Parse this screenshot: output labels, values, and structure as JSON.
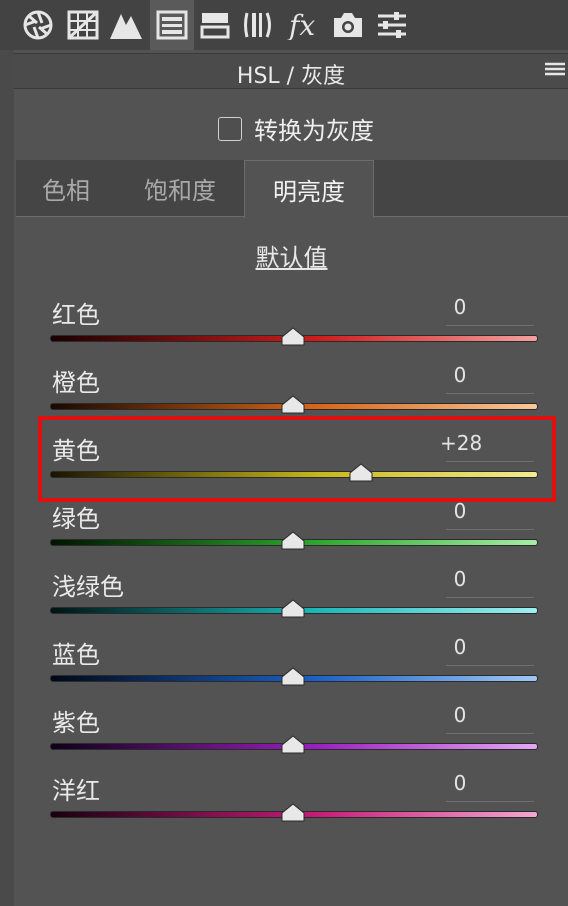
{
  "toolbar": {
    "tools": [
      {
        "icon": "aperture-icon"
      },
      {
        "icon": "tone-curve-grid-icon"
      },
      {
        "icon": "mountain-detail-icon"
      },
      {
        "icon": "hsl-panel-icon",
        "active": true
      },
      {
        "icon": "split-toning-icon"
      },
      {
        "icon": "lens-corrections-icon"
      },
      {
        "icon": "fx-icon"
      },
      {
        "icon": "camera-icon"
      },
      {
        "icon": "sliders-presets-icon"
      }
    ]
  },
  "panel": {
    "title": "HSL / 灰度",
    "menu_icon": "panel-menu-icon"
  },
  "convert_gray": {
    "label": "转换为灰度",
    "checked": false
  },
  "tabs": [
    {
      "label": "色相",
      "active": false
    },
    {
      "label": "饱和度",
      "active": false
    },
    {
      "label": "明亮度",
      "active": true
    }
  ],
  "default_link": "默认值",
  "sliders": [
    {
      "label": "红色",
      "value": "0",
      "level": 0
    },
    {
      "label": "橙色",
      "value": "0",
      "level": 0
    },
    {
      "label": "黄色",
      "value": "+28",
      "level": 28
    },
    {
      "label": "绿色",
      "value": "0",
      "level": 0
    },
    {
      "label": "浅绿色",
      "value": "0",
      "level": 0
    },
    {
      "label": "蓝色",
      "value": "0",
      "level": 0
    },
    {
      "label": "紫色",
      "value": "0",
      "level": 0
    },
    {
      "label": "洋红",
      "value": "0",
      "level": 0
    }
  ],
  "colors": {
    "highlight": "#e01010",
    "tracks": [
      [
        "#1a0000",
        "#d01c1c",
        "#f5a0a0"
      ],
      [
        "#1a0800",
        "#d8661a",
        "#f8c898"
      ],
      [
        "#1a1400",
        "#c8b818",
        "#f4ec90"
      ],
      [
        "#001400",
        "#2ea82e",
        "#a8eca8"
      ],
      [
        "#001414",
        "#1cb8b8",
        "#a0f0f0"
      ],
      [
        "#000818",
        "#1c62c8",
        "#a0c8f4"
      ],
      [
        "#100018",
        "#9c20c0",
        "#e4a8f4"
      ],
      [
        "#180010",
        "#c81c78",
        "#f4a8d0"
      ]
    ]
  }
}
